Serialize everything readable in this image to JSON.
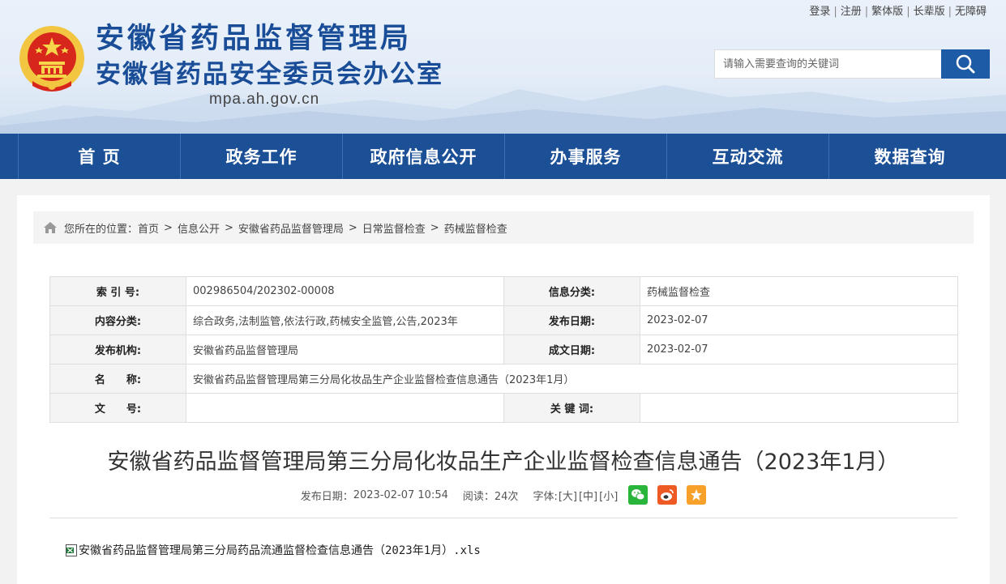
{
  "header": {
    "title": "安徽省药品监督管理局",
    "subtitle": "安徽省药品安全委员会办公室",
    "domain": "mpa.ah.gov.cn",
    "links": [
      "登录",
      "注册",
      "繁体版",
      "长辈版",
      "无障碍"
    ]
  },
  "search": {
    "placeholder": "请输入需要查询的关键词"
  },
  "nav": [
    "首 页",
    "政务工作",
    "政府信息公开",
    "办事服务",
    "互动交流",
    "数据查询"
  ],
  "breadcrumb": {
    "prefix": "您所在的位置：",
    "items": [
      "首页",
      "信息公开",
      "安徽省药品监督管理局",
      "日常监督检查",
      "药械监督检查"
    ]
  },
  "meta": {
    "index_label": "索 引 号:",
    "index_value": "002986504/202302-00008",
    "category_label": "信息分类:",
    "category_value": "药械监督检查",
    "content_type_label": "内容分类:",
    "content_type_value": "综合政务,法制监管,依法行政,药械安全监管,公告,2023年",
    "publish_date_label": "发布日期:",
    "publish_date_value": "2023-02-07",
    "org_label": "发布机构:",
    "org_value": "安徽省药品监督管理局",
    "created_date_label": "成文日期:",
    "created_date_value": "2023-02-07",
    "name_label": "名　　称:",
    "name_value": "安徽省药品监督管理局第三分局化妆品生产企业监督检查信息通告（2023年1月）",
    "doc_no_label": "文　　号:",
    "doc_no_value": "",
    "keywords_label": "关 键 词:",
    "keywords_value": ""
  },
  "article": {
    "title": "安徽省药品监督管理局第三分局化妆品生产企业监督检查信息通告（2023年1月）",
    "publish_label": "发布日期：",
    "publish_time": "2023-02-07 10:54",
    "views_label": "阅读：",
    "views": "24次",
    "fontsize_label": "字体:",
    "fontsize_large": "[大]",
    "fontsize_medium": "[中]",
    "fontsize_small": "[小]",
    "attachment": "安徽省药品监督管理局第三分局药品流通监督检查信息通告（2023年1月）.xls"
  },
  "colors": {
    "brand_blue": "#1b4f96",
    "title_blue": "#1a4d97",
    "wechat_green": "#29b43b",
    "weibo_orange": "#ee5a24",
    "favorite_orange": "#f7a12a"
  },
  "icons": [
    "national-emblem-icon",
    "search-icon",
    "home-icon",
    "wechat-icon",
    "weibo-icon",
    "favorite-star-icon",
    "xls-file-icon"
  ]
}
